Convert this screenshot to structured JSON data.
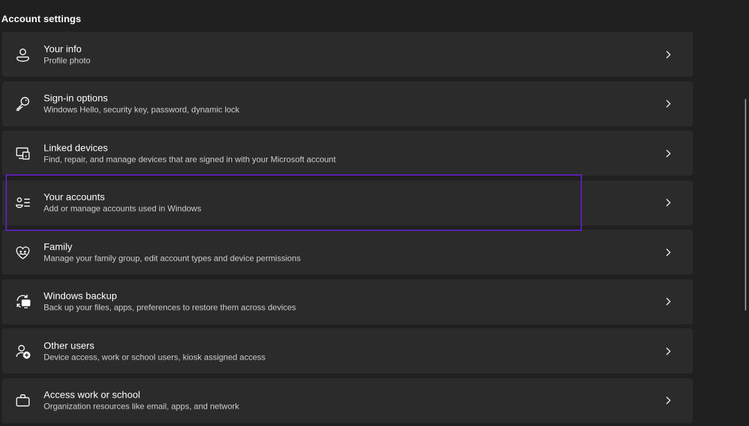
{
  "section": {
    "title": "Account settings"
  },
  "items": [
    {
      "title": "Your info",
      "subtitle": "Profile photo",
      "icon": "person-icon"
    },
    {
      "title": "Sign-in options",
      "subtitle": "Windows Hello, security key, password, dynamic lock",
      "icon": "key-icon"
    },
    {
      "title": "Linked devices",
      "subtitle": "Find, repair, and manage devices that are signed in with your Microsoft account",
      "icon": "linked-devices-icon"
    },
    {
      "title": "Your accounts",
      "subtitle": "Add or manage accounts used in Windows",
      "icon": "accounts-list-icon"
    },
    {
      "title": "Family",
      "subtitle": "Manage your family group, edit account types and device permissions",
      "icon": "family-heart-icon"
    },
    {
      "title": "Windows backup",
      "subtitle": "Back up your files, apps, preferences to restore them across devices",
      "icon": "backup-icon"
    },
    {
      "title": "Other users",
      "subtitle": "Device access, work or school users, kiosk assigned access",
      "icon": "add-user-icon"
    },
    {
      "title": "Access work or school",
      "subtitle": "Organization resources like email, apps, and network",
      "icon": "briefcase-icon"
    }
  ],
  "highlight_color": "#5b21b6"
}
